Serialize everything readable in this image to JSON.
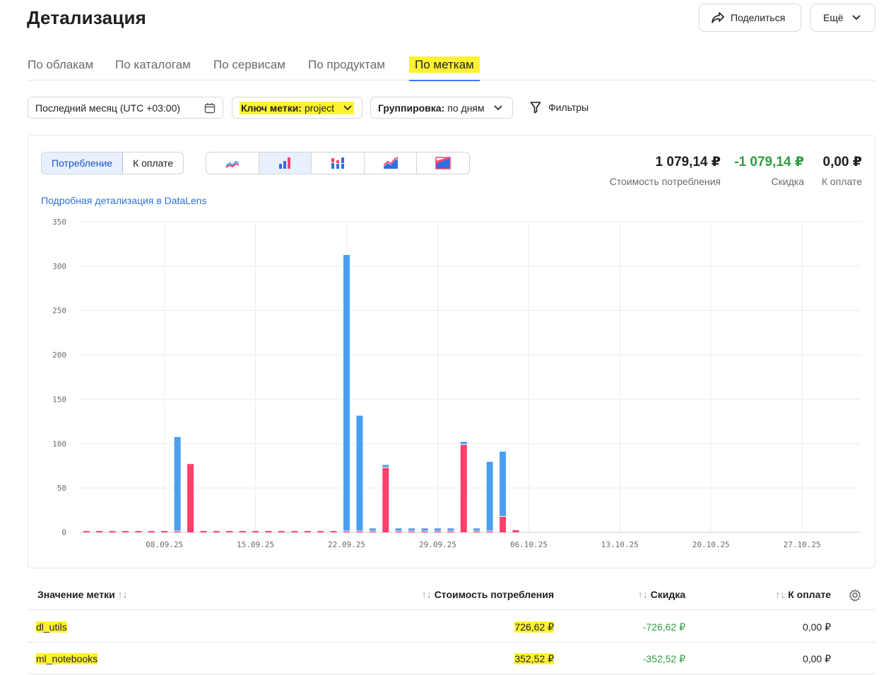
{
  "header": {
    "title": "Детализация",
    "share_label": "Поделиться",
    "more_label": "Ещё"
  },
  "tabs": [
    {
      "label": "По облакам",
      "active": false
    },
    {
      "label": "По каталогам",
      "active": false
    },
    {
      "label": "По сервисам",
      "active": false
    },
    {
      "label": "По продуктам",
      "active": false
    },
    {
      "label": "По меткам",
      "active": true
    }
  ],
  "filters": {
    "period": "Последний месяц (UTC +03:00)",
    "label_key_name": "Ключ метки:",
    "label_key_value": "project",
    "grouping_name": "Группировка:",
    "grouping_value": "по дням",
    "filters_label": "Фильтры"
  },
  "view": {
    "modes": [
      "Потребление",
      "К оплате"
    ],
    "active_mode": "Потребление",
    "chart_types": [
      "line-chart-icon",
      "bar-chart-icon",
      "stacked-bar-chart-icon",
      "area-chart-icon",
      "stacked-area-chart-icon"
    ],
    "active_chart_type": "bar-chart-icon"
  },
  "summary": [
    {
      "value": "1 079,14 ₽",
      "label": "Стоимость потребления",
      "color": "#1f1f1f"
    },
    {
      "value": "-1 079,14 ₽",
      "label": "Скидка",
      "color": "#2e9e3f"
    },
    {
      "value": "0,00 ₽",
      "label": "К оплате",
      "color": "#1f1f1f"
    }
  ],
  "datalens_link": "Подробная детализация в DataLens",
  "colors": {
    "accent": "#3a7afe",
    "dl_utils": "#4a9ff0",
    "ml_notebooks": "#ff3f6c",
    "highlight": "#fff230",
    "positive_discount": "#2e9e3f"
  },
  "chart_data": {
    "type": "bar",
    "stacked": true,
    "ylim": [
      0,
      350
    ],
    "yticks": [
      0,
      50,
      100,
      150,
      200,
      250,
      300,
      350
    ],
    "x_start": "2025-09-02",
    "x_ticks": [
      "08.09.25",
      "15.09.25",
      "22.09.25",
      "29.09.25",
      "06.10.25",
      "13.10.25",
      "20.10.25",
      "27.10.25"
    ],
    "days_total": 60,
    "grid": true,
    "series": [
      {
        "name": "ml_notebooks",
        "color": "#ff3f6c",
        "values": [
          1.5,
          1.5,
          1.5,
          1.5,
          1.5,
          1.5,
          1.5,
          1.5,
          77,
          1.5,
          1.5,
          1.5,
          1.5,
          1.5,
          1.5,
          1.5,
          1.5,
          1.5,
          1.5,
          1.5,
          1.5,
          1.5,
          1.5,
          73,
          1.5,
          1.5,
          1.5,
          1.5,
          1.5,
          99,
          1.5,
          1.5,
          18,
          2.5
        ]
      },
      {
        "name": "dl_utils",
        "color": "#4a9ff0",
        "values": [
          0,
          0,
          0,
          0,
          0,
          0,
          0,
          106,
          0,
          0,
          0,
          0,
          0,
          0,
          0,
          0,
          0,
          0,
          0,
          0,
          311,
          130,
          3,
          3,
          3,
          3,
          3,
          3,
          3,
          3,
          3,
          78,
          73
        ]
      }
    ]
  },
  "table": {
    "columns": [
      "Значение метки",
      "Стоимость потребления",
      "Скидка",
      "К оплате"
    ],
    "rows": [
      {
        "label": "dl_utils",
        "cost": "726,62 ₽",
        "discount": "-726,62 ₽",
        "pay": "0,00 ₽"
      },
      {
        "label": "ml_notebooks",
        "cost": "352,52 ₽",
        "discount": "-352,52 ₽",
        "pay": "0,00 ₽"
      }
    ]
  }
}
